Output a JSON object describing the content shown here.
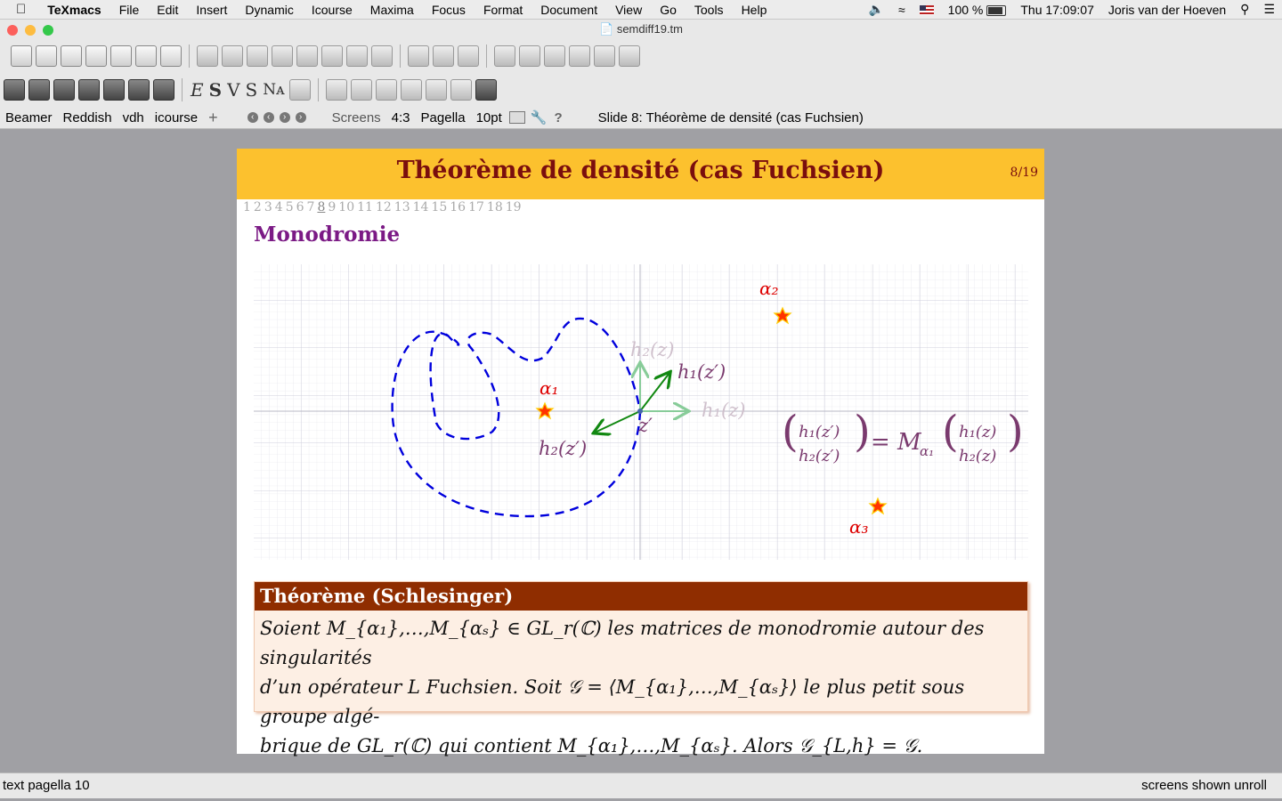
{
  "menubar": {
    "app": "TeXmacs",
    "items": [
      "File",
      "Edit",
      "Insert",
      "Dynamic",
      "Icourse",
      "Maxima",
      "Focus",
      "Format",
      "Document",
      "View",
      "Go",
      "Tools",
      "Help"
    ],
    "battery": "100 %",
    "clock": "Thu 17:09:07",
    "user": "Joris van der Hoeven"
  },
  "window": {
    "title": "semdiff19.tm"
  },
  "toolbar2_glyphs": [
    "E",
    "S",
    "V",
    "S",
    "Nᴀ"
  ],
  "focusbar": {
    "items": [
      "Beamer",
      "Reddish",
      "vdh",
      "icourse",
      "+"
    ],
    "screens": "Screens",
    "ratio": "4:3",
    "font": "Pagella",
    "size": "10pt",
    "slide_label": "Slide 8: Théorème de densité (cas Fuchsien)"
  },
  "slide": {
    "title": "Théorème de densité (cas Fuchsien)",
    "counter": "8/19",
    "nav": [
      "1",
      "2",
      "3",
      "4",
      "5",
      "6",
      "7",
      "8",
      "9",
      "10",
      "11",
      "12",
      "13",
      "14",
      "15",
      "16",
      "17",
      "18",
      "19"
    ],
    "current": "8",
    "section": "Monodromie"
  },
  "diagram": {
    "labels": {
      "alpha1": "α₁",
      "alpha2": "α₂",
      "alpha3": "α₃",
      "h1z": "h₁(z)",
      "h2z": "h₂(z)",
      "h1zp": "h₁(z′)",
      "h2zp": "h₂(z′)",
      "zp": "z′",
      "matrix_top_left": "h₁(z′)",
      "matrix_bottom_left": "h₂(z′)",
      "matrix_eq": "= M",
      "matrix_sub": "α₁",
      "matrix_top_right": "h₁(z)",
      "matrix_bottom_right": "h₂(z)"
    },
    "colors": {
      "curve": "#0000dd",
      "arrows": "#118811",
      "light_arrows": "#88cc99",
      "stars": "#ee1100",
      "labels": "#7a3a6e",
      "alpha": "#dd0000"
    }
  },
  "theorem": {
    "heading": "Théorème (Schlesinger)",
    "line1": "Soient M_{α₁},…,M_{αₛ} ∈ GL_r(ℂ) les matrices de monodromie autour des singularités",
    "line2": "d’un opérateur L Fuchsien.  Soit 𝒢 = ⟨M_{α₁},…,M_{αₛ}⟩ le plus petit sous groupe algé-",
    "line3": "brique de GL_r(ℂ) qui contient M_{α₁},…,M_{αₛ}.  Alors 𝒢_{L,h} = 𝒢."
  },
  "status": {
    "left": "text pagella 10",
    "right": "screens shown unroll"
  }
}
